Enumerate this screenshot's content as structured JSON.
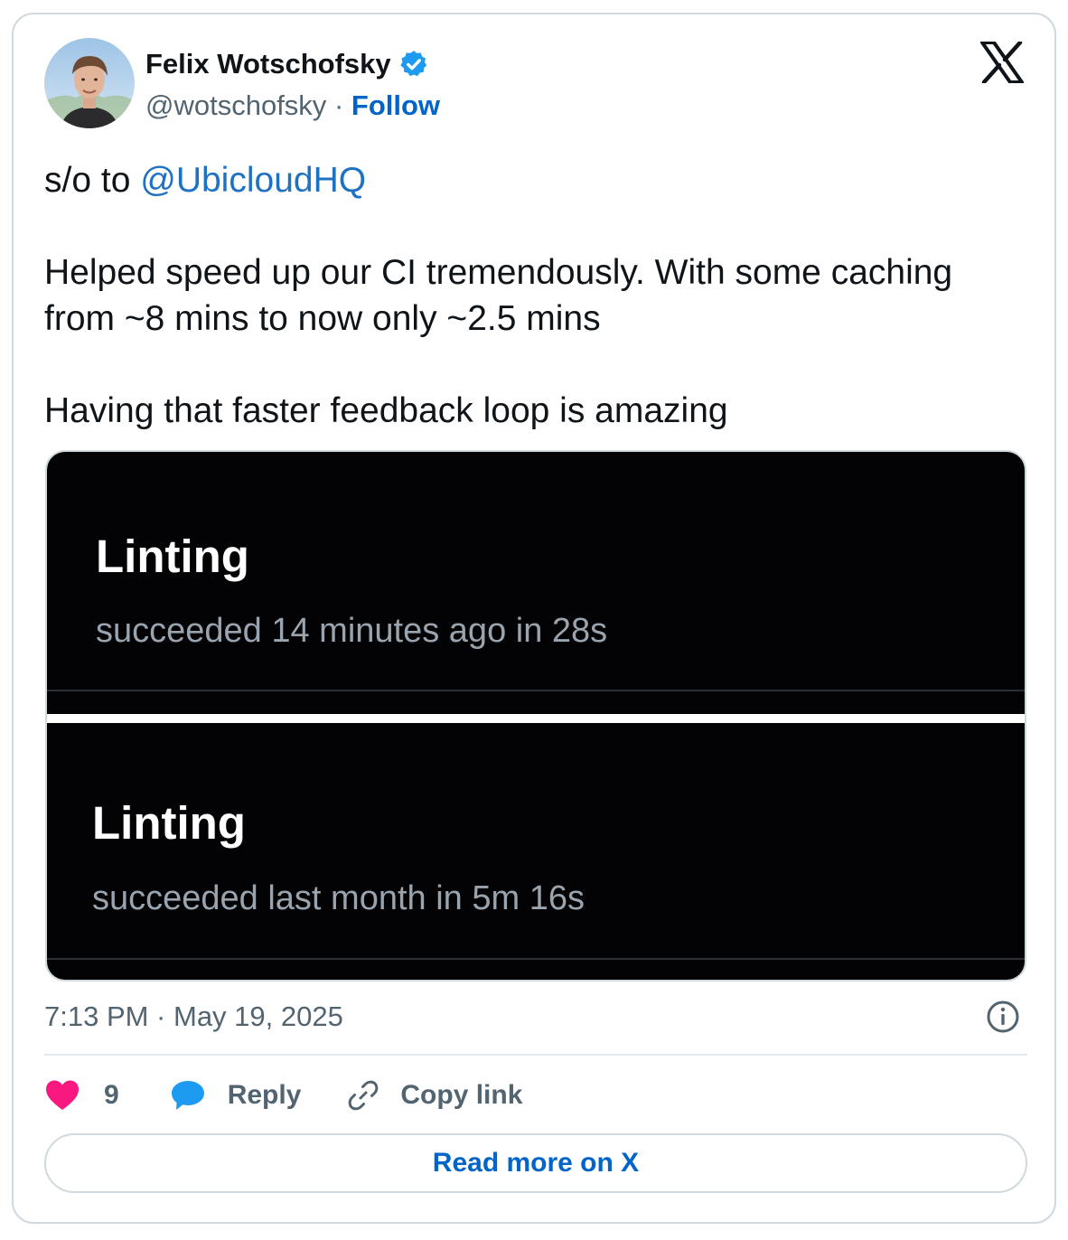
{
  "author": {
    "name": "Felix Wotschofsky",
    "handle": "@wotschofsky",
    "separator": "·",
    "follow_label": "Follow",
    "verified": true
  },
  "tweet": {
    "line1_prefix": "s/o to ",
    "mention": "@UbicloudHQ",
    "paragraph2_line1": "Helped speed up our CI tremendously. With some caching",
    "paragraph2_line2": "from ~8 mins to now only ~2.5 mins",
    "paragraph3": "Having that faster feedback loop is amazing"
  },
  "media": {
    "panels": [
      {
        "title": "Linting",
        "status": "succeeded 14 minutes ago in 28s"
      },
      {
        "title": "Linting",
        "status": "succeeded last month in 5m 16s"
      }
    ]
  },
  "meta": {
    "timestamp": "7:13 PM · May 19, 2025"
  },
  "actions": {
    "like_count": "9",
    "reply_label": "Reply",
    "copy_link_label": "Copy link"
  },
  "read_more_label": "Read more on X",
  "colors": {
    "link": "#1d72c4",
    "follow": "#0064c8",
    "heart": "#f91880",
    "reply_bubble": "#1d9bf0",
    "verified": "#1d9bf0"
  },
  "icons": [
    "verified-badge-icon",
    "x-logo-icon",
    "info-icon",
    "heart-icon",
    "reply-bubble-icon",
    "link-icon"
  ]
}
